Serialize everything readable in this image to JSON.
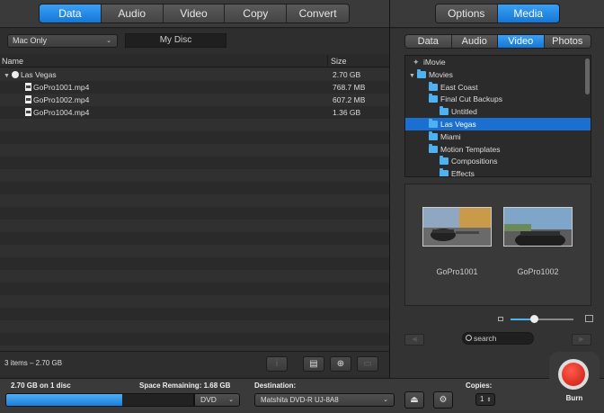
{
  "main_tabs": [
    "Data",
    "Audio",
    "Video",
    "Copy",
    "Convert"
  ],
  "side_tabs": [
    "Options",
    "Media"
  ],
  "format_select": "Mac Only",
  "disc_name": "My Disc",
  "columns": {
    "name": "Name",
    "size": "Size"
  },
  "files": [
    {
      "name": "Las Vegas",
      "size": "2.70 GB",
      "type": "folder"
    },
    {
      "name": "GoPro1001.mp4",
      "size": "768.7 MB",
      "type": "file"
    },
    {
      "name": "GoPro1002.mp4",
      "size": "607.2 MB",
      "type": "file"
    },
    {
      "name": "GoPro1004.mp4",
      "size": "1.36 GB",
      "type": "file"
    }
  ],
  "status": "3 items – 2.70 GB",
  "media_tabs": [
    "Data",
    "Audio",
    "Video",
    "Photos"
  ],
  "media_tree": [
    {
      "label": "iMovie",
      "icon": "star-icon",
      "indent": 0,
      "arrow": ""
    },
    {
      "label": "Movies",
      "icon": "folder-icon",
      "indent": 0,
      "arrow": "▼"
    },
    {
      "label": "East Coast",
      "icon": "folder-icon",
      "indent": 1,
      "arrow": ""
    },
    {
      "label": "Final Cut Backups",
      "icon": "folder-icon",
      "indent": 1,
      "arrow": ""
    },
    {
      "label": "Untitled",
      "icon": "folder-icon",
      "indent": 2,
      "arrow": ""
    },
    {
      "label": "Las Vegas",
      "icon": "folder-icon",
      "indent": 1,
      "arrow": "",
      "selected": true
    },
    {
      "label": "Miami",
      "icon": "folder-icon",
      "indent": 1,
      "arrow": ""
    },
    {
      "label": "Motion Templates",
      "icon": "folder-icon",
      "indent": 1,
      "arrow": ""
    },
    {
      "label": "Compositions",
      "icon": "folder-icon",
      "indent": 2,
      "arrow": ""
    },
    {
      "label": "Effects",
      "icon": "folder-icon",
      "indent": 2,
      "arrow": ""
    }
  ],
  "thumbnails": [
    {
      "label": "GoPro1001"
    },
    {
      "label": "GoPro1002"
    }
  ],
  "search_placeholder": "search",
  "bottom": {
    "capacity_label": "2.70 GB on 1 disc",
    "space_remaining": "Space Remaining: 1.68 GB",
    "destination_label": "Destination:",
    "disc_type": "DVD",
    "destination": "Matshita DVD-R   UJ-8A8",
    "copies_label": "Copies:",
    "copies": "1",
    "burn_label": "Burn",
    "fill_fraction": 0.62
  },
  "colors": {
    "accent": "#1b7fd8",
    "burn": "#d5231a"
  }
}
